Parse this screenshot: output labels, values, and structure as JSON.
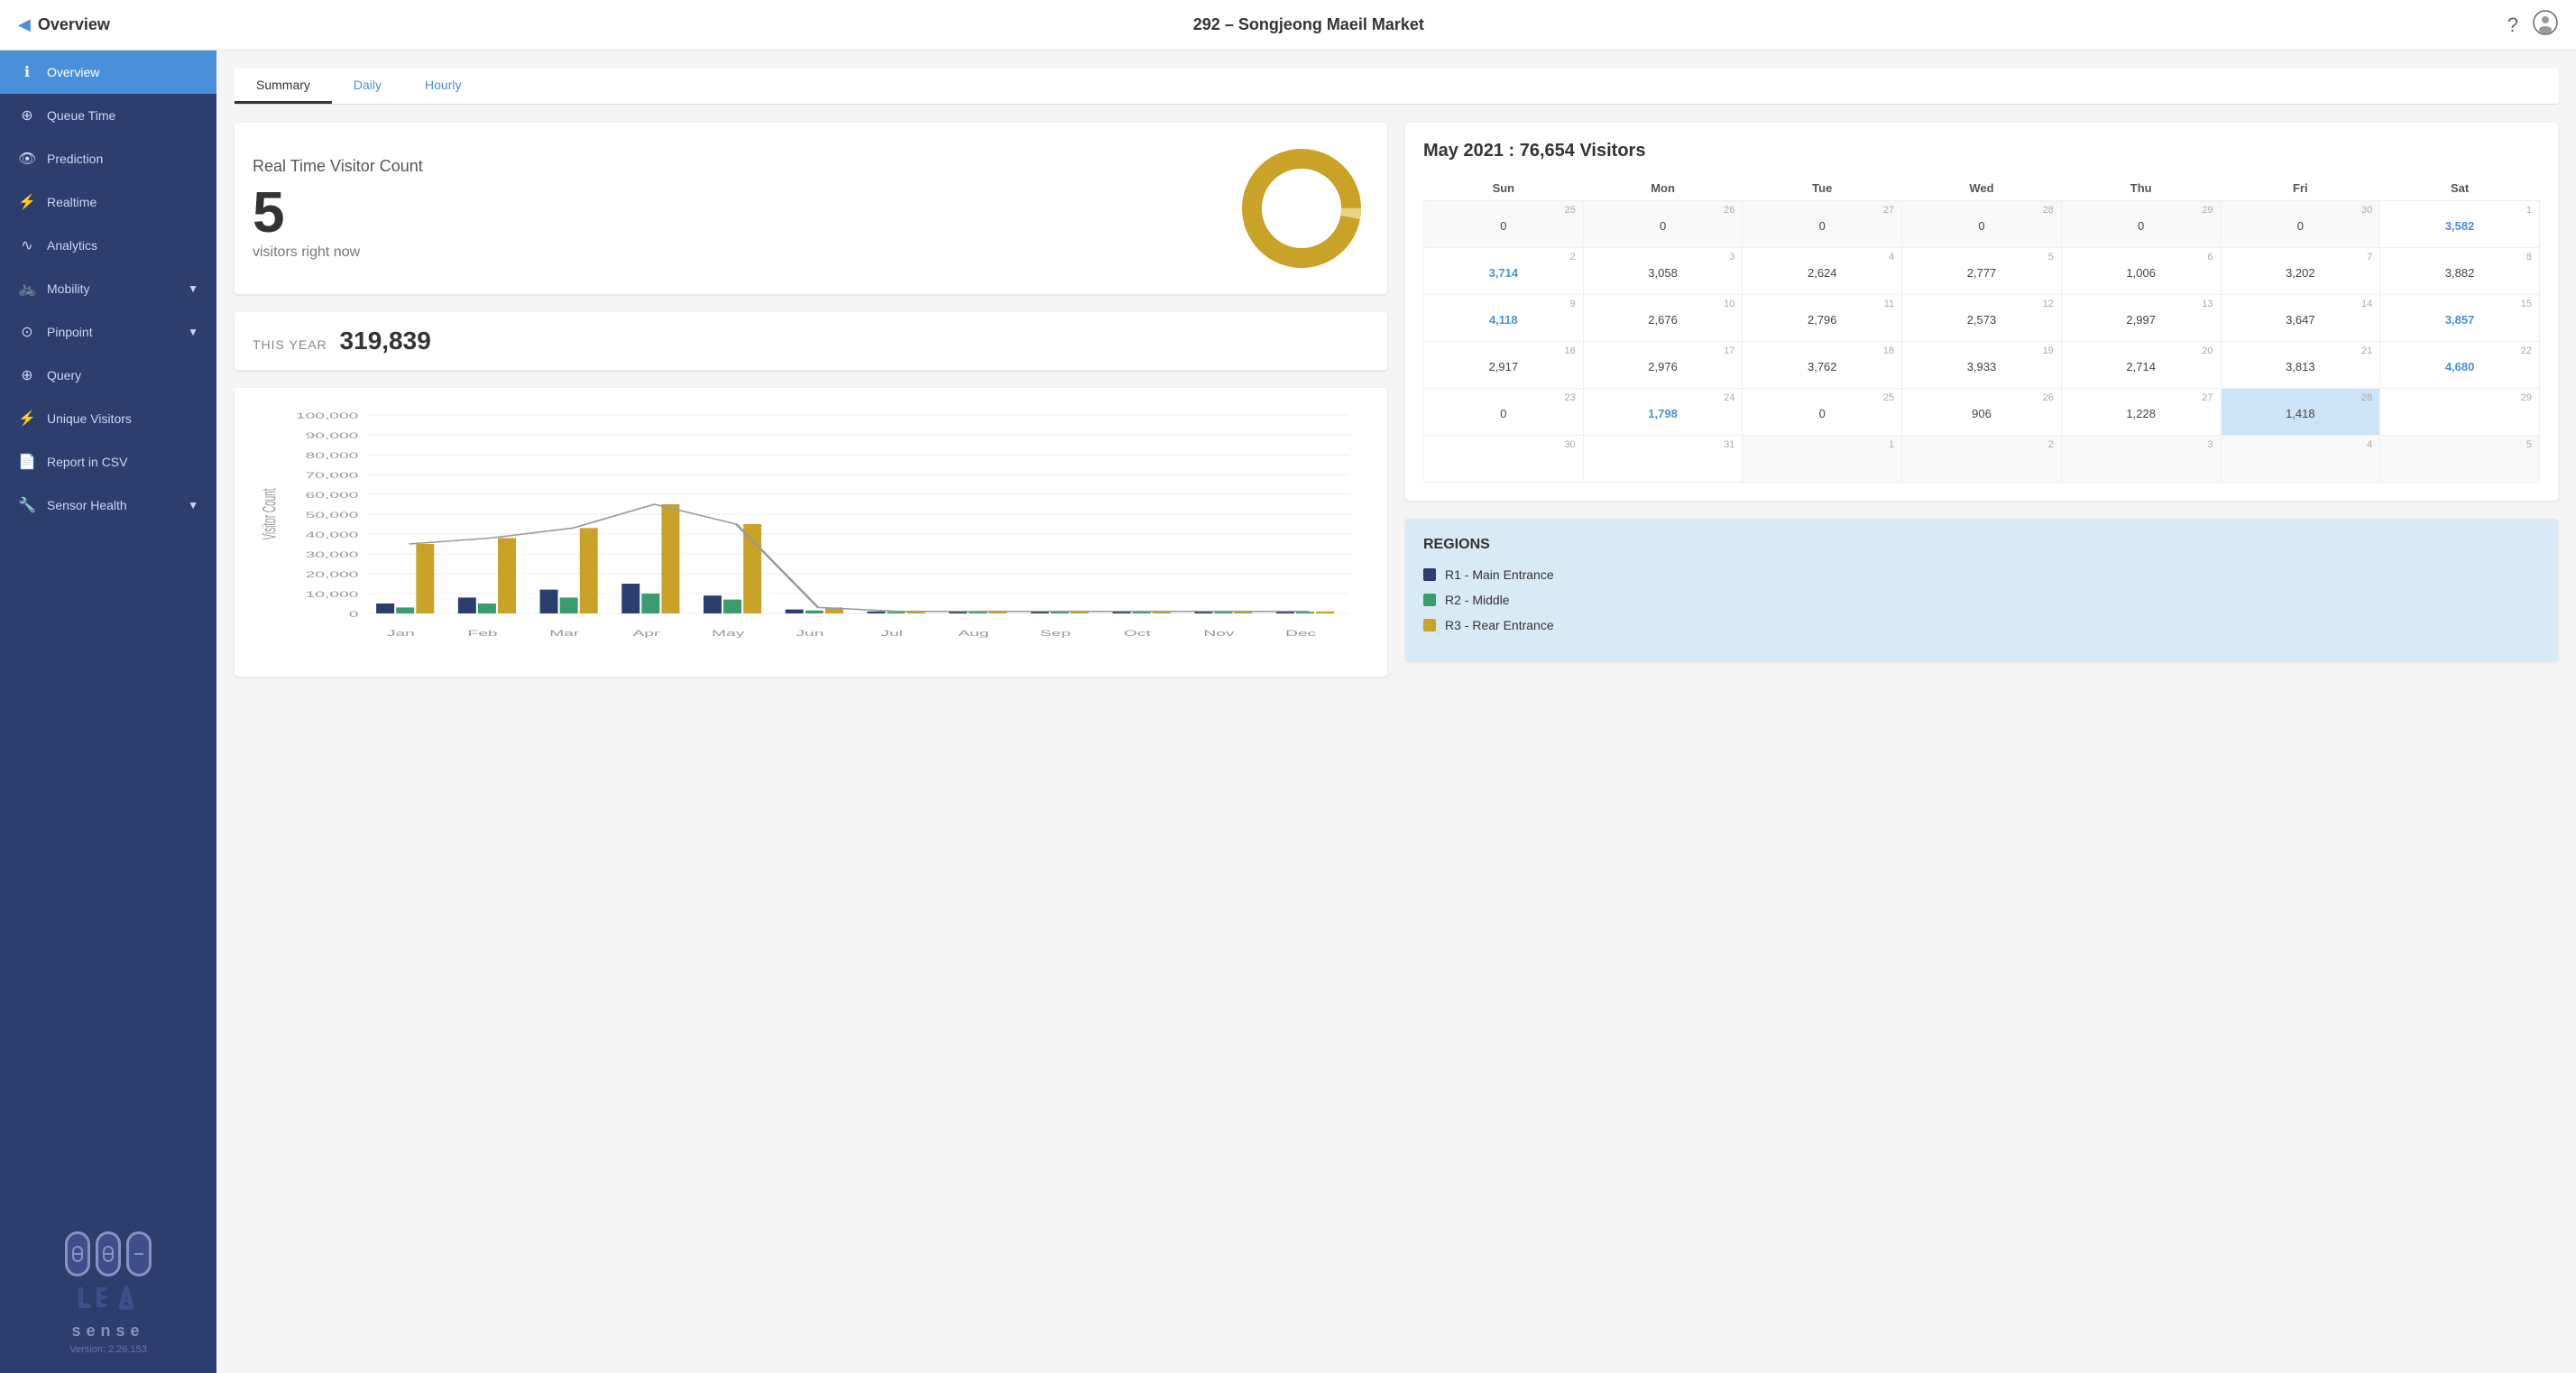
{
  "header": {
    "back_label": "Overview",
    "store_name": "292 – Songjeong Maeil Market",
    "help_icon": "?",
    "user_icon": "👤"
  },
  "sidebar": {
    "items": [
      {
        "id": "overview",
        "label": "Overview",
        "icon": "ℹ",
        "active": true,
        "has_chevron": false
      },
      {
        "id": "queue-time",
        "label": "Queue Time",
        "icon": "⊕",
        "active": false,
        "has_chevron": false
      },
      {
        "id": "prediction",
        "label": "Prediction",
        "icon": "👁",
        "active": false,
        "has_chevron": false
      },
      {
        "id": "realtime",
        "label": "Realtime",
        "icon": "⚡",
        "active": false,
        "has_chevron": false
      },
      {
        "id": "analytics",
        "label": "Analytics",
        "icon": "∿",
        "active": false,
        "has_chevron": false
      },
      {
        "id": "mobility",
        "label": "Mobility",
        "icon": "🚲",
        "active": false,
        "has_chevron": true
      },
      {
        "id": "pinpoint",
        "label": "Pinpoint",
        "icon": "⊙",
        "active": false,
        "has_chevron": true
      },
      {
        "id": "query",
        "label": "Query",
        "icon": "⊕",
        "active": false,
        "has_chevron": false
      },
      {
        "id": "unique-visitors",
        "label": "Unique Visitors",
        "icon": "⚡",
        "active": false,
        "has_chevron": false
      },
      {
        "id": "report-csv",
        "label": "Report in CSV",
        "icon": "📄",
        "active": false,
        "has_chevron": false
      },
      {
        "id": "sensor-health",
        "label": "Sensor Health",
        "icon": "🔧",
        "active": false,
        "has_chevron": true
      }
    ],
    "version": "Version: 2.26.153"
  },
  "tabs": [
    {
      "id": "summary",
      "label": "Summary",
      "active": true
    },
    {
      "id": "daily",
      "label": "Daily",
      "active": false
    },
    {
      "id": "hourly",
      "label": "Hourly",
      "active": false
    }
  ],
  "realtime": {
    "label": "Real Time Visitor Count",
    "count": "5",
    "sub_label": "visitors right now"
  },
  "thisyear": {
    "label": "THIS YEAR",
    "value": "319,839"
  },
  "calendar": {
    "title": "May 2021 : 76,654 Visitors",
    "headers": [
      "Sun",
      "Mon",
      "Tue",
      "Wed",
      "Thu",
      "Fri",
      "Sat"
    ],
    "weeks": [
      [
        {
          "num": "25",
          "val": "0",
          "type": "gray"
        },
        {
          "num": "26",
          "val": "0",
          "type": "gray"
        },
        {
          "num": "27",
          "val": "0",
          "type": "gray"
        },
        {
          "num": "28",
          "val": "0",
          "type": "gray"
        },
        {
          "num": "29",
          "val": "0",
          "type": "gray"
        },
        {
          "num": "30",
          "val": "0",
          "type": "gray"
        },
        {
          "num": "1",
          "val": "3,582",
          "type": "blue"
        }
      ],
      [
        {
          "num": "2",
          "val": "3,714",
          "type": "blue"
        },
        {
          "num": "3",
          "val": "3,058",
          "type": "normal"
        },
        {
          "num": "4",
          "val": "2,624",
          "type": "normal"
        },
        {
          "num": "5",
          "val": "2,777",
          "type": "normal"
        },
        {
          "num": "6",
          "val": "1,006",
          "type": "normal"
        },
        {
          "num": "7",
          "val": "3,202",
          "type": "normal"
        },
        {
          "num": "8",
          "val": "3,882",
          "type": "normal"
        }
      ],
      [
        {
          "num": "9",
          "val": "4,118",
          "type": "blue"
        },
        {
          "num": "10",
          "val": "2,676",
          "type": "normal"
        },
        {
          "num": "11",
          "val": "2,796",
          "type": "normal"
        },
        {
          "num": "12",
          "val": "2,573",
          "type": "normal"
        },
        {
          "num": "13",
          "val": "2,997",
          "type": "normal"
        },
        {
          "num": "14",
          "val": "3,647",
          "type": "normal"
        },
        {
          "num": "15",
          "val": "3,857",
          "type": "blue"
        }
      ],
      [
        {
          "num": "16",
          "val": "2,917",
          "type": "normal"
        },
        {
          "num": "17",
          "val": "2,976",
          "type": "normal"
        },
        {
          "num": "18",
          "val": "3,762",
          "type": "normal"
        },
        {
          "num": "19",
          "val": "3,933",
          "type": "normal"
        },
        {
          "num": "20",
          "val": "2,714",
          "type": "normal"
        },
        {
          "num": "21",
          "val": "3,813",
          "type": "normal"
        },
        {
          "num": "22",
          "val": "4,680",
          "type": "blue"
        }
      ],
      [
        {
          "num": "23",
          "val": "0",
          "type": "normal"
        },
        {
          "num": "24",
          "val": "1,798",
          "type": "blue"
        },
        {
          "num": "25",
          "val": "0",
          "type": "normal"
        },
        {
          "num": "26",
          "val": "906",
          "type": "normal"
        },
        {
          "num": "27",
          "val": "1,228",
          "type": "normal"
        },
        {
          "num": "28",
          "val": "1,418",
          "type": "highlighted"
        },
        {
          "num": "29",
          "val": "",
          "type": "normal"
        }
      ],
      [
        {
          "num": "30",
          "val": "",
          "type": "normal"
        },
        {
          "num": "31",
          "val": "",
          "type": "normal"
        },
        {
          "num": "1",
          "val": "",
          "type": "gray"
        },
        {
          "num": "2",
          "val": "",
          "type": "gray"
        },
        {
          "num": "3",
          "val": "",
          "type": "gray"
        },
        {
          "num": "4",
          "val": "",
          "type": "gray"
        },
        {
          "num": "5",
          "val": "",
          "type": "gray"
        }
      ]
    ]
  },
  "regions": {
    "title": "REGIONS",
    "items": [
      {
        "label": "R1 - Main Entrance",
        "color": "#2c3e6e"
      },
      {
        "label": "R2 - Middle",
        "color": "#3a9d6e"
      },
      {
        "label": "R3 - Rear Entrance",
        "color": "#c9a227"
      }
    ]
  },
  "chart": {
    "y_labels": [
      "100,000",
      "90,000",
      "80,000",
      "70,000",
      "60,000",
      "50,000",
      "40,000",
      "30,000",
      "20,000",
      "10,000",
      "0"
    ],
    "x_labels": [
      "Jan",
      "Feb",
      "Mar",
      "Apr",
      "May",
      "Jun",
      "Jul",
      "Aug",
      "Sep",
      "Oct",
      "Nov",
      "Dec"
    ],
    "y_axis_label": "Visitor Count",
    "bars_r1": [
      5000,
      8000,
      12000,
      15000,
      9000,
      2000,
      1000,
      1000,
      1000,
      1000,
      1000,
      1000
    ],
    "bars_r2": [
      3000,
      5000,
      8000,
      10000,
      7000,
      1500,
      800,
      800,
      800,
      800,
      800,
      800
    ],
    "bars_r3": [
      35000,
      38000,
      43000,
      55000,
      45000,
      3000,
      1000,
      1000,
      1000,
      1000,
      1000,
      1000
    ],
    "max_value": 100000
  },
  "colors": {
    "accent_blue": "#4a90d9",
    "sidebar_bg": "#2c3e6e",
    "r1_color": "#2c3e6e",
    "r2_color": "#3a9d6e",
    "r3_color": "#c9a227",
    "donut_color": "#c9a227"
  }
}
